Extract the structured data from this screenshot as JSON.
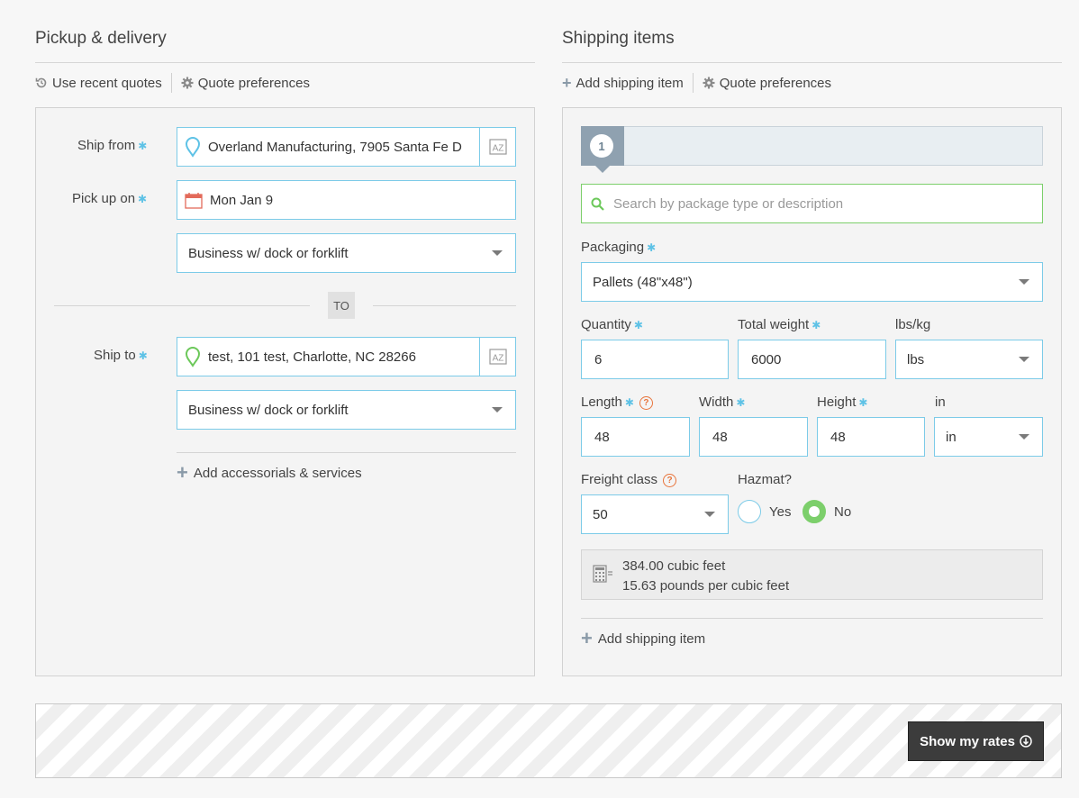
{
  "left": {
    "title": "Pickup & delivery",
    "toolbar": {
      "recent_quotes": "Use recent quotes",
      "preferences": "Quote preferences"
    },
    "ship_from": {
      "label": "Ship from",
      "value": "Overland Manufacturing, 7905 Santa Fe D"
    },
    "pickup": {
      "label": "Pick up on",
      "value": "Mon Jan 9"
    },
    "pickup_location_type": "Business w/ dock or forklift",
    "to_badge": "TO",
    "ship_to": {
      "label": "Ship to",
      "value": "test, 101 test, Charlotte, NC 28266"
    },
    "delivery_location_type": "Business w/ dock or forklift",
    "add_accessorials": "Add accessorials & services",
    "az_label": "AZ"
  },
  "right": {
    "title": "Shipping items",
    "toolbar": {
      "add_item": "Add shipping item",
      "preferences": "Quote preferences"
    },
    "item_number": "1",
    "search_placeholder": "Search by package type or description",
    "packaging": {
      "label": "Packaging",
      "value": "Pallets (48\"x48\")"
    },
    "quantity": {
      "label": "Quantity",
      "value": "6"
    },
    "total_weight": {
      "label": "Total weight",
      "value": "6000"
    },
    "weight_unit": {
      "label": "lbs/kg",
      "value": "lbs"
    },
    "length": {
      "label": "Length",
      "value": "48"
    },
    "width": {
      "label": "Width",
      "value": "48"
    },
    "height": {
      "label": "Height",
      "value": "48"
    },
    "dim_unit": {
      "label": "in",
      "value": "in"
    },
    "freight_class": {
      "label": "Freight class",
      "value": "50"
    },
    "hazmat": {
      "label": "Hazmat?",
      "yes": "Yes",
      "no": "No",
      "selected": "No"
    },
    "calc": {
      "volume": "384.00 cubic feet",
      "density": "15.63 pounds per cubic feet"
    },
    "add_item_bottom": "Add shipping item"
  },
  "footer": {
    "show_rates": "Show my rates"
  },
  "colors": {
    "input_border": "#7ccbe8",
    "required": "#5ec2e6",
    "green": "#7ccf6b",
    "button": "#3c3c3c",
    "help": "#e8743b"
  }
}
